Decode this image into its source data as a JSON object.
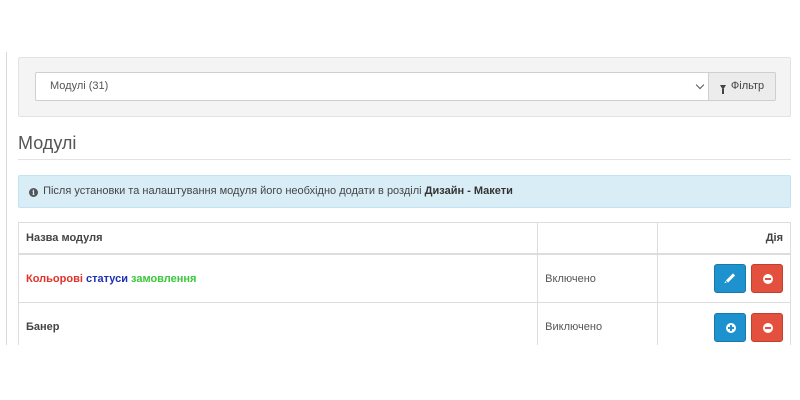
{
  "filter": {
    "select_value": "Модулі (31)",
    "button_label": "Фільтр"
  },
  "page": {
    "title": "Модулі"
  },
  "alert": {
    "text": "Після установки та налаштування модуля його необхідно додати в розділі",
    "link": "Дизайн - Макети"
  },
  "table": {
    "headers": {
      "name": "Назва модуля",
      "status": "",
      "action": "Дія"
    },
    "rows": [
      {
        "name_parts": [
          "Кольорові",
          "статуси",
          "замовлення"
        ],
        "status": "Включено",
        "primary_action": "edit",
        "secondary_action": "uninstall"
      },
      {
        "name": "Банер",
        "status": "Виключено",
        "primary_action": "install",
        "secondary_action": "uninstall"
      }
    ]
  },
  "colors": {
    "primary": "#1e91cf",
    "danger": "#e3503e",
    "info_bg": "#d9edf7",
    "name_red": "#e3302a",
    "name_blue": "#1f2fb5",
    "name_green": "#39c93a"
  },
  "icons": {
    "filter": "funnel-icon",
    "info": "info-circle-icon",
    "edit": "pencil-icon",
    "install": "plus-circle-icon",
    "uninstall": "minus-circle-icon",
    "dropdown": "chevron-down-icon"
  }
}
